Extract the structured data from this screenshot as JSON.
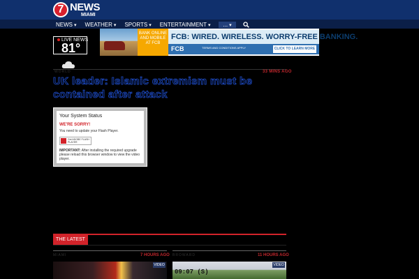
{
  "header": {
    "logo_numeral": "7",
    "logo_brand": "NEWS",
    "logo_city": "MIAMI",
    "brand_color": "#10306d"
  },
  "nav": {
    "items": [
      "NEWS",
      "WEATHER",
      "SPORTS",
      "ENTERTAINMENT"
    ],
    "more_label": "...",
    "search_icon": "search-icon"
  },
  "weather": {
    "live_label": "LIVE NEWS",
    "temperature": "81°",
    "condition_icon": "cloud-icon"
  },
  "ad": {
    "yellow_text": "BANK ONLINE AND MOBILE AT FCB",
    "headline": "FCB: WIRED. WIRELESS. WORRY-FREE BANKING.",
    "brand": "FCB",
    "terms": "TERMS AND CONDITIONS APPLY",
    "cta": "CLICK TO LEARN MORE"
  },
  "story": {
    "kicker": "WORLD",
    "time_ago": "33 MINS AGO",
    "headline": "UK leader: Islamic extremism must be contained after attack",
    "accent_color": "#c2272d"
  },
  "flash": {
    "title": "Your System Status",
    "sorry": "WE'RE SORRY!",
    "message": "You need to update your Flash Player.",
    "badge": "Get ADOBE FLASH PLAYER",
    "important_label": "IMPORTANT:",
    "important_text": "After installing the required upgrade please reload this browser window to view the video player."
  },
  "latest": {
    "label": "THE LATEST",
    "cards": [
      {
        "kicker": "MIAMI",
        "time_ago": "7 HOURS AGO",
        "badge": "VIDEO"
      },
      {
        "kicker": "BROWARD",
        "time_ago": "11 HOURS AGO",
        "badge": "VIDEO",
        "timestamp": "09:07 (S)"
      }
    ]
  }
}
